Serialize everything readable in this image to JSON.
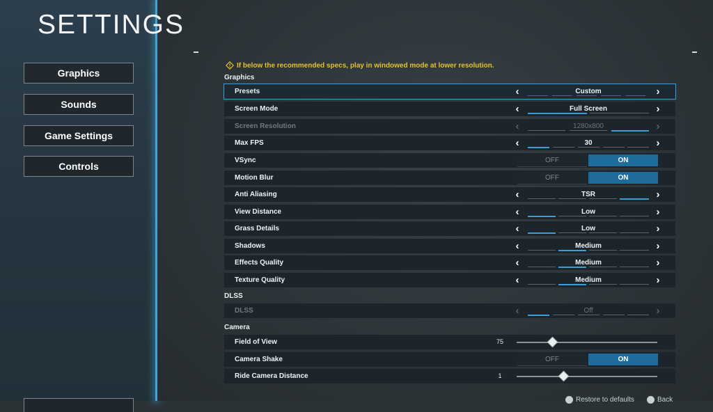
{
  "page": {
    "title": "SETTINGS"
  },
  "nav": [
    {
      "label": "Graphics",
      "selected": true
    },
    {
      "label": "Sounds"
    },
    {
      "label": "Game Settings"
    },
    {
      "label": "Controls"
    }
  ],
  "warning": "If below the recommended specs, play in windowed mode at lower resolution.",
  "graphics": {
    "title": "Graphics",
    "presets": {
      "label": "Presets",
      "value": "Custom"
    },
    "screen_mode": {
      "label": "Screen Mode",
      "value": "Full Screen"
    },
    "screen_resolution": {
      "label": "Screen Resolution",
      "value": "1280x800"
    },
    "max_fps": {
      "label": "Max FPS",
      "value": "30"
    },
    "vsync": {
      "label": "VSync",
      "off": "OFF",
      "on": "ON"
    },
    "motion_blur": {
      "label": "Motion Blur",
      "off": "OFF",
      "on": "ON"
    },
    "anti_aliasing": {
      "label": "Anti Aliasing",
      "value": "TSR"
    },
    "view_distance": {
      "label": "View Distance",
      "value": "Low"
    },
    "grass_details": {
      "label": "Grass Details",
      "value": "Low"
    },
    "shadows": {
      "label": "Shadows",
      "value": "Medium"
    },
    "effects_quality": {
      "label": "Effects Quality",
      "value": "Medium"
    },
    "texture_quality": {
      "label": "Texture Quality",
      "value": "Medium"
    }
  },
  "dlss": {
    "title": "DLSS",
    "dlss": {
      "label": "DLSS",
      "value": "Off"
    }
  },
  "camera": {
    "title": "Camera",
    "field_of_view": {
      "label": "Field of View",
      "value": "75",
      "level": 0.25
    },
    "camera_shake": {
      "label": "Camera Shake",
      "off": "OFF",
      "on": "ON"
    },
    "ride_camera_distance": {
      "label": "Ride Camera Distance",
      "value": "1",
      "level": 0.33
    }
  },
  "footer": {
    "restore": "Restore to defaults",
    "back": "Back"
  },
  "colors": {
    "accent": "#3fa6d6",
    "warning": "#e4c12f",
    "toggle_on": "#1e6c9c"
  }
}
